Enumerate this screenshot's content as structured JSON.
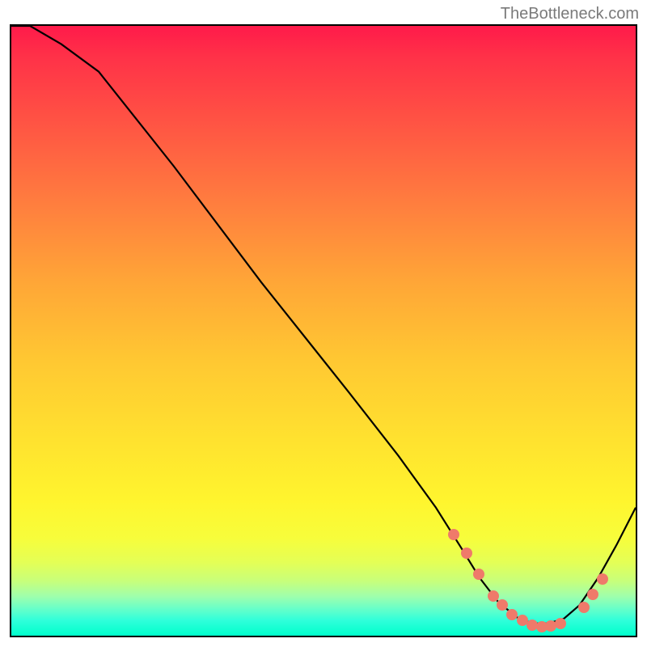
{
  "watermark": "TheBottleneck.com",
  "chart_data": {
    "type": "line",
    "title": "",
    "xlabel": "",
    "ylabel": "",
    "xlim": [
      0,
      100
    ],
    "ylim": [
      0,
      100
    ],
    "curve": [
      {
        "x": 0,
        "y": 100
      },
      {
        "x": 3,
        "y": 100
      },
      {
        "x": 8,
        "y": 97
      },
      {
        "x": 14,
        "y": 92.5
      },
      {
        "x": 26,
        "y": 77
      },
      {
        "x": 40,
        "y": 58
      },
      {
        "x": 54,
        "y": 40
      },
      {
        "x": 62,
        "y": 29.5
      },
      {
        "x": 68,
        "y": 21
      },
      {
        "x": 72,
        "y": 14.5
      },
      {
        "x": 75,
        "y": 9.5
      },
      {
        "x": 78,
        "y": 5.5
      },
      {
        "x": 81,
        "y": 3
      },
      {
        "x": 83.5,
        "y": 2
      },
      {
        "x": 86,
        "y": 2
      },
      {
        "x": 88.5,
        "y": 2.8
      },
      {
        "x": 91,
        "y": 5
      },
      {
        "x": 94,
        "y": 9.5
      },
      {
        "x": 97,
        "y": 15
      },
      {
        "x": 100,
        "y": 21
      }
    ],
    "dots": [
      {
        "x": 70.5,
        "y": 17
      },
      {
        "x": 72.5,
        "y": 14
      },
      {
        "x": 74.5,
        "y": 10.5
      },
      {
        "x": 76.8,
        "y": 7
      },
      {
        "x": 78.2,
        "y": 5.5
      },
      {
        "x": 79.8,
        "y": 4
      },
      {
        "x": 81.5,
        "y": 3
      },
      {
        "x": 83,
        "y": 2.3
      },
      {
        "x": 84.5,
        "y": 2
      },
      {
        "x": 86,
        "y": 2.1
      },
      {
        "x": 87.5,
        "y": 2.5
      },
      {
        "x": 91.2,
        "y": 5.2
      },
      {
        "x": 92.7,
        "y": 7.2
      },
      {
        "x": 94.2,
        "y": 9.8
      }
    ]
  }
}
